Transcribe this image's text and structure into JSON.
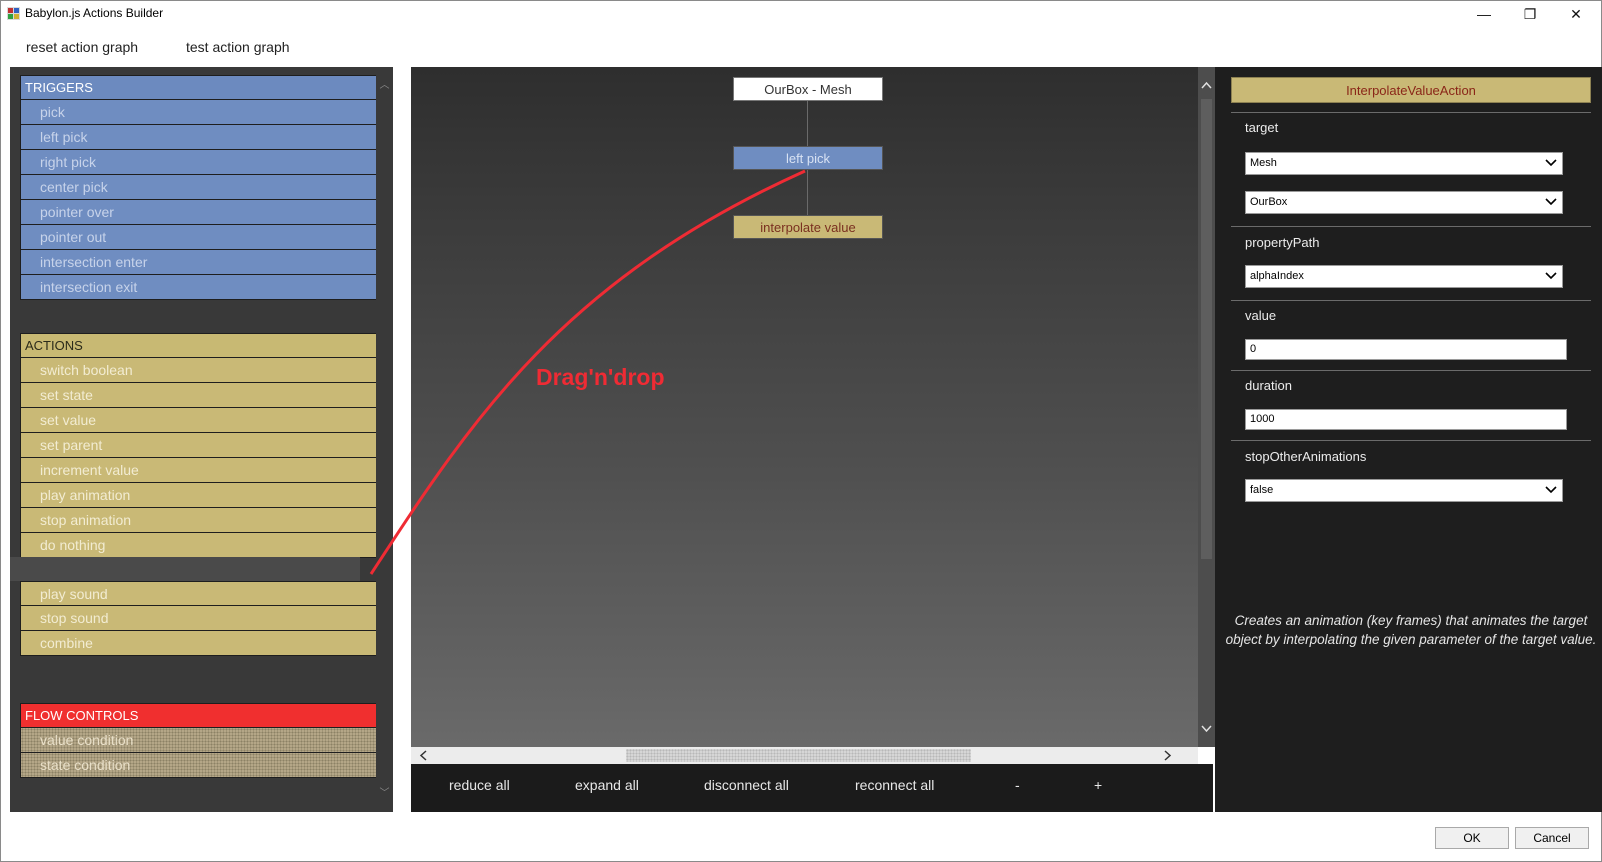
{
  "window": {
    "title": "Babylon.js Actions Builder",
    "minimize": "—",
    "maximize": "❐",
    "close": "✕"
  },
  "menu": {
    "reset": "reset action graph",
    "test": "test action graph"
  },
  "left": {
    "triggers": {
      "header": "TRIGGERS",
      "items": [
        "pick",
        "left pick",
        "right pick",
        "center pick",
        "pointer over",
        "pointer out",
        "intersection enter",
        "intersection exit"
      ]
    },
    "actions": {
      "header": "ACTIONS",
      "items": [
        "switch boolean",
        "set state",
        "set value",
        "set parent",
        "increment value",
        "play animation",
        "stop animation",
        "do nothing"
      ],
      "items2": [
        "play sound",
        "stop sound",
        "combine"
      ]
    },
    "flow": {
      "header": "FLOW CONTROLS",
      "items": [
        "value condition",
        "state condition"
      ]
    },
    "scroll_up": "︿",
    "scroll_down": "﹀"
  },
  "graph": {
    "mesh_node": "OurBox - Mesh",
    "trigger_node": "left pick",
    "action_node": "interpolate value",
    "annotation": "Drag'n'drop"
  },
  "toolbar": {
    "reduce": "reduce all",
    "expand": "expand all",
    "disconnect": "disconnect all",
    "reconnect": "reconnect all",
    "minus": "-",
    "plus": "+"
  },
  "right": {
    "action_title": "InterpolateValueAction",
    "target_label": "target",
    "target_type": "Mesh",
    "target_name": "OurBox",
    "property_label": "propertyPath",
    "property_value": "alphaIndex",
    "value_label": "value",
    "value_value": "0",
    "duration_label": "duration",
    "duration_value": "1000",
    "stop_label": "stopOtherAnimations",
    "stop_value": "false",
    "description": "Creates an animation (key frames) that animates the target object by interpolating the given parameter of the target value."
  },
  "dialog": {
    "ok": "OK",
    "cancel": "Cancel"
  },
  "colors": {
    "trigger": "#6f8dc1",
    "action": "#c9b976",
    "flow": "#f02f2f",
    "annotation": "#ef2b34"
  }
}
